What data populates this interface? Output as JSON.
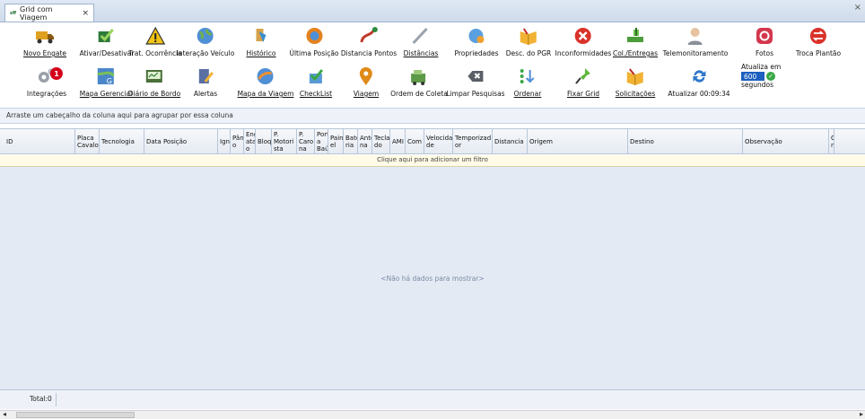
{
  "tab": {
    "title": "Grid com Viagem",
    "close": "×",
    "logo": "sff"
  },
  "window_close": "×",
  "toolbar": {
    "row1": [
      {
        "label": "Novo Engate",
        "icon": "truck-icon",
        "ul": true
      },
      {
        "label": "Ativar/Desativar",
        "icon": "checkbox-icon",
        "ul": false
      },
      {
        "label": "Trat. Ocorrência",
        "icon": "warning-icon",
        "ul": false
      },
      {
        "label": "Interação Veículo",
        "icon": "globe-icon",
        "ul": false
      },
      {
        "label": "Histórico",
        "icon": "history-icon",
        "ul": true
      },
      {
        "label": "Última Posição",
        "icon": "last-position-icon",
        "ul": false
      },
      {
        "label": "Distancia Pontos",
        "icon": "route-icon",
        "ul": false
      },
      {
        "label": "Distâncias",
        "icon": "ruler-icon",
        "ul": true
      },
      {
        "label": "Propriedades",
        "icon": "properties-icon",
        "ul": false
      },
      {
        "label": "Desc. do PGR",
        "icon": "book-icon",
        "ul": false
      },
      {
        "label": "Inconformidades",
        "icon": "error-icon",
        "ul": false
      },
      {
        "label": "Col./Entregas",
        "icon": "delivery-icon",
        "ul": true
      },
      {
        "label": "Telemonitoramento",
        "icon": "person-icon",
        "ul": false
      },
      {
        "label": "Fotos",
        "icon": "camera-icon",
        "ul": false
      },
      {
        "label": "Troca Plantão",
        "icon": "shift-swap-icon",
        "ul": false
      }
    ],
    "row2": [
      {
        "label": "Integrações",
        "icon": "gears-icon",
        "ul": false,
        "badge": "1"
      },
      {
        "label": "Mapa Gerencial",
        "icon": "map-icon",
        "ul": true
      },
      {
        "label": "Diário de Bordo",
        "icon": "logbook-icon",
        "ul": true
      },
      {
        "label": "Alertas",
        "icon": "alert-icon",
        "ul": false
      },
      {
        "label": "Mapa da Viagem",
        "icon": "trip-map-icon",
        "ul": true
      },
      {
        "label": "CheckList",
        "icon": "checklist-icon",
        "ul": true
      },
      {
        "label": "Viagem",
        "icon": "pin-icon",
        "ul": true
      },
      {
        "label": "Ordem de Coleta",
        "icon": "collection-order-icon",
        "ul": false
      },
      {
        "label": "Limpar Pesquisas",
        "icon": "clear-icon",
        "ul": false
      },
      {
        "label": "Ordenar",
        "icon": "sort-icon",
        "ul": true
      },
      {
        "label": "Fixar Grid",
        "icon": "pushpin-icon",
        "ul": true
      },
      {
        "label": "Solicitações",
        "icon": "requests-icon",
        "ul": true
      },
      {
        "label": "Atualizar 00:09:34",
        "icon": "refresh-icon",
        "ul": false
      }
    ],
    "refresh_box": {
      "label": "Atualiza em",
      "value": "600",
      "unit": "segundos"
    }
  },
  "group_area": "Arraste um cabeçalho da coluna aqui para agrupar por essa coluna",
  "columns": [
    "ID",
    "Placa\nCavalo",
    "Tecnologia",
    "Data Posição",
    "Ign",
    "Pânic\no",
    "Eng\natad\no",
    "Bloq",
    "P.\nMotori\nsta",
    "P.\nCaro\nna",
    "Port\na\nBaú",
    "Pain\nel",
    "Bate\nria",
    "Ante\nna",
    "Tecla\ndo",
    "AMI",
    "Com",
    "Velocida\nde",
    "Temporizad\nor",
    "Distancia",
    "Origem",
    "Destino",
    "Observação",
    "C\nn"
  ],
  "filter_row": "Clique aqui para adicionar um filtro",
  "no_data": "<Não há dados para mostrar>",
  "footer": {
    "total": "Total:0"
  },
  "scroll": {
    "left": "◂",
    "right": "▸",
    "grip": "III"
  },
  "colors": {
    "badge": "#d4001a",
    "accent": "#1e5fbf"
  }
}
